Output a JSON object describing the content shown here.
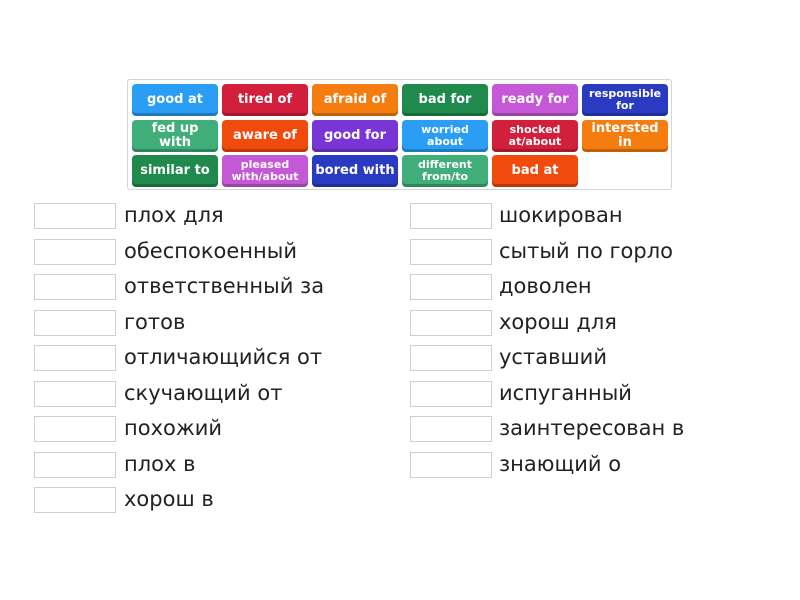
{
  "tiles": [
    {
      "text": "good at",
      "color": "#2a9df4"
    },
    {
      "text": "tired of",
      "color": "#d21f3c"
    },
    {
      "text": "afraid of",
      "color": "#f57c0f"
    },
    {
      "text": "bad for",
      "color": "#1f8a4c"
    },
    {
      "text": "ready for",
      "color": "#c558d6"
    },
    {
      "text": "responsible for",
      "color": "#2a3bc2"
    },
    {
      "text": "fed up with",
      "color": "#3fae78"
    },
    {
      "text": "aware of",
      "color": "#f04a0c"
    },
    {
      "text": "good for",
      "color": "#7a35d6"
    },
    {
      "text": "worried about",
      "color": "#2a9df4"
    },
    {
      "text": "shocked at/about",
      "color": "#d21f3c"
    },
    {
      "text": "intersted in",
      "color": "#f57c0f"
    },
    {
      "text": "similar to",
      "color": "#1f8a4c"
    },
    {
      "text": "pleased with/about",
      "color": "#c558d6"
    },
    {
      "text": "bored with",
      "color": "#2a3bc2"
    },
    {
      "text": "different from/to",
      "color": "#3fae78"
    },
    {
      "text": "bad at",
      "color": "#f04a0c"
    }
  ],
  "left_items": [
    "плох для",
    "обеспокоенный",
    "ответственный за",
    "готов",
    "отличающийся от",
    "скучающий от",
    "похожий",
    "плох в",
    "хорош в"
  ],
  "right_items": [
    "шокирован",
    "сытый по горло",
    "доволен",
    "хорош для",
    "уставший",
    "испуганный",
    "заинтересован в",
    "знающий о"
  ]
}
